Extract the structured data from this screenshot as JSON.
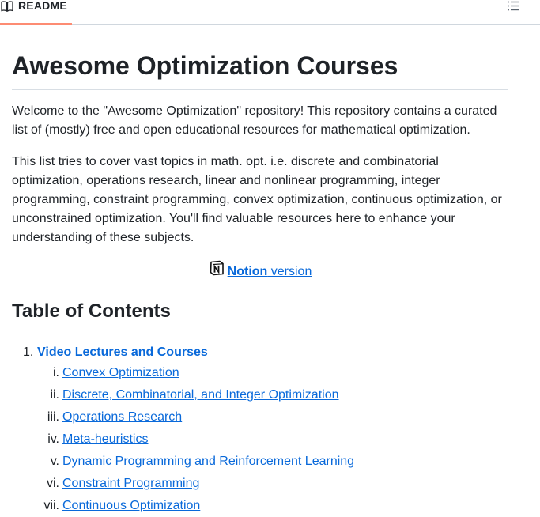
{
  "tab": {
    "label": "README",
    "icon": "book-icon",
    "accent_color": "#fd8c73"
  },
  "toolbar": {
    "outline_icon": "list-icon"
  },
  "article": {
    "title": "Awesome Optimization Courses",
    "paragraph1": "Welcome to the \"Awesome Optimization\" repository! This repository contains a curated list of (mostly) free and open educational resources for mathematical optimization.",
    "paragraph2": "This list tries to cover vast topics in math. opt. i.e. discrete and combinatorial optimization, operations research, linear and nonlinear programming, integer programming, constraint programming, convex optimization, continuous optimization, or unconstrained optimization. You'll find valuable resources here to enhance your understanding of these subjects.",
    "notion_link": {
      "bold": "Notion",
      "rest": " version",
      "icon": "notion-icon"
    }
  },
  "toc": {
    "title": "Table of Contents",
    "items": [
      {
        "num": "1.",
        "label": "Video Lectures and Courses",
        "children": [
          {
            "num": "i.",
            "label": "Convex Optimization"
          },
          {
            "num": "ii.",
            "label": "Discrete, Combinatorial, and Integer Optimization"
          },
          {
            "num": "iii.",
            "label": "Operations Research"
          },
          {
            "num": "iv.",
            "label": "Meta-heuristics"
          },
          {
            "num": "v.",
            "label": "Dynamic Programming and Reinforcement Learning"
          },
          {
            "num": "vi.",
            "label": "Constraint Programming"
          },
          {
            "num": "vii.",
            "label": "Continuous Optimization"
          }
        ]
      }
    ]
  },
  "colors": {
    "link": "#0969da",
    "text": "#1f2328",
    "border": "#d0d7de"
  }
}
